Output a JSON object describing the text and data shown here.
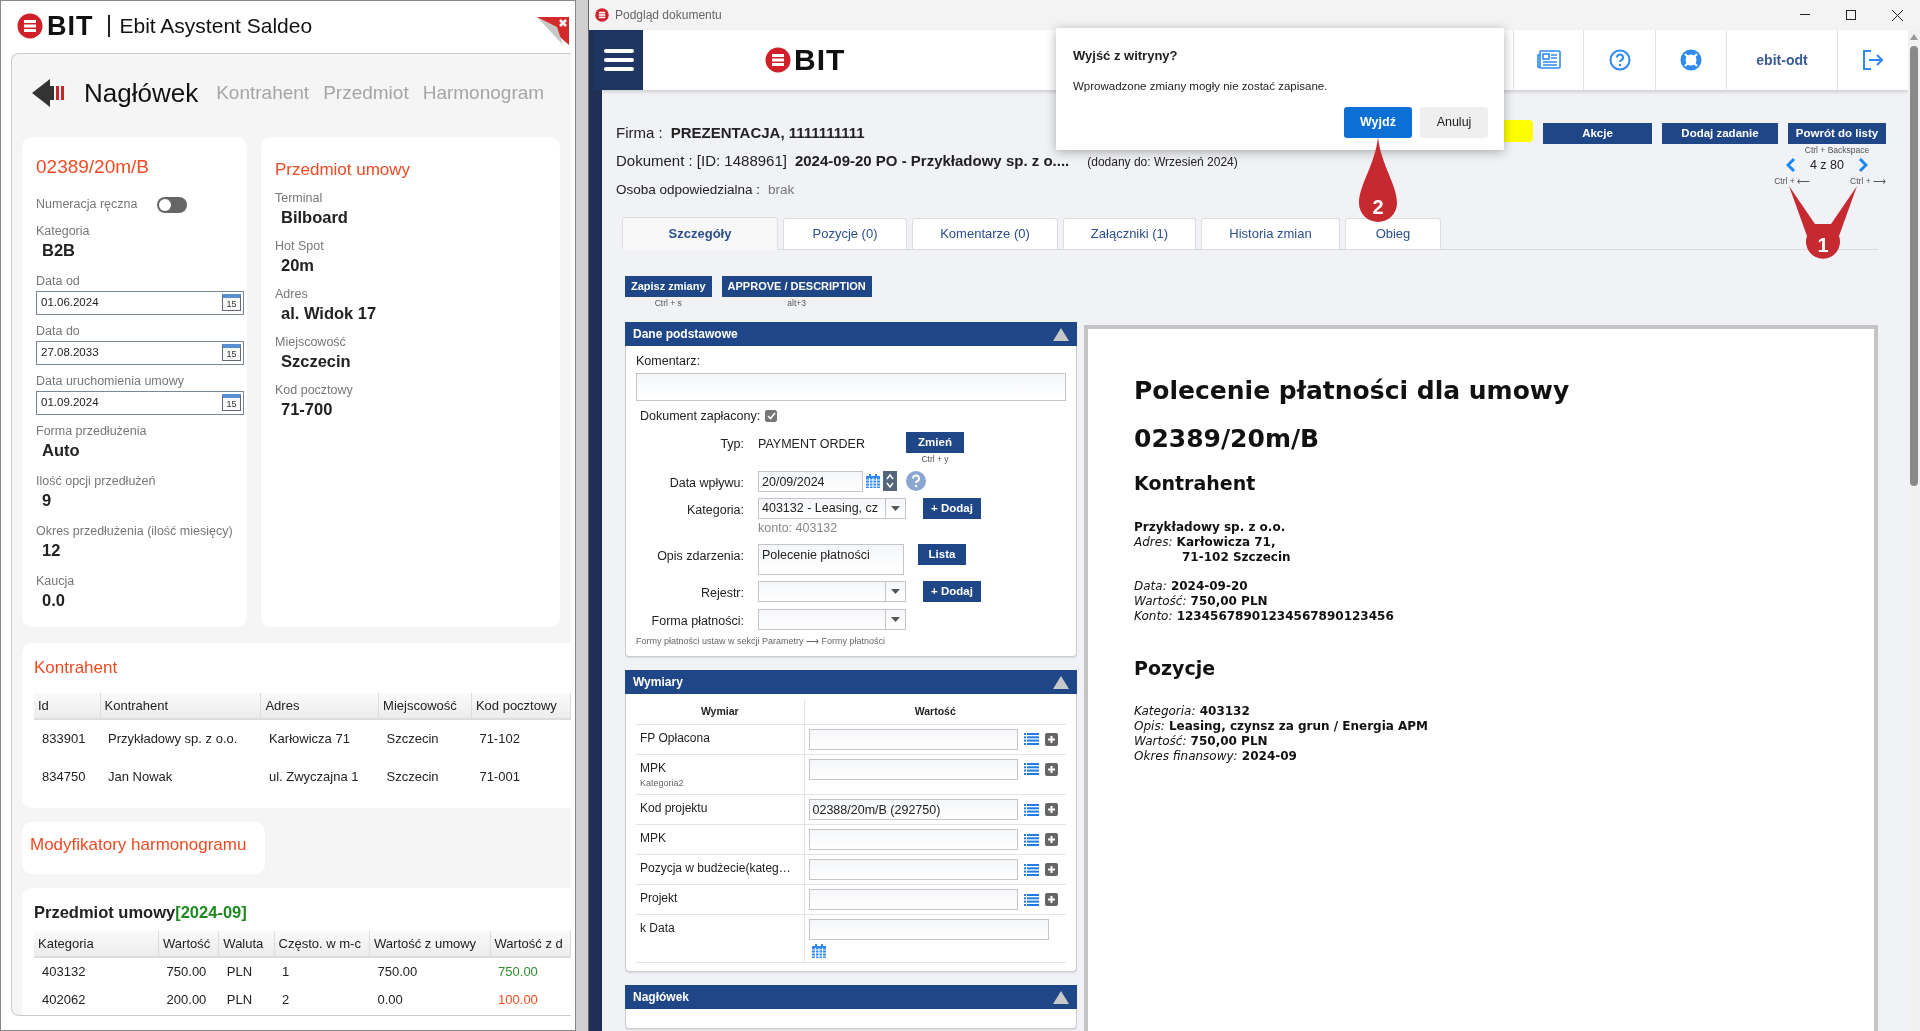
{
  "left_window": {
    "logo_text": "BIT",
    "title": "Ebit Asystent Saldeo",
    "nav": [
      {
        "label": "Nagłówek",
        "selected": true
      },
      {
        "label": "Kontrahent",
        "selected": false
      },
      {
        "label": "Przedmiot",
        "selected": false
      },
      {
        "label": "Harmonogram",
        "selected": false
      }
    ],
    "contract_card": {
      "number": "02389/20m/B",
      "toggle": {
        "label": "Numeracja ręczna",
        "on": false
      },
      "fields": [
        {
          "kind": "value",
          "label": "Kategoria",
          "value": "B2B"
        },
        {
          "kind": "date",
          "label": "Data od",
          "value": "01.06.2024",
          "calendar": "15"
        },
        {
          "kind": "date",
          "label": "Data do",
          "value": "27.08.2033",
          "calendar": "15"
        },
        {
          "kind": "date",
          "label": "Data uruchomienia umowy",
          "value": "01.09.2024",
          "calendar": "15"
        },
        {
          "kind": "value",
          "label": "Forma przedłużenia",
          "value": "Auto"
        },
        {
          "kind": "value",
          "label": "Ilość opcji przedłużeń",
          "value": "9"
        },
        {
          "kind": "value",
          "label": "Okres przedłużenia (ilość miesięcy)",
          "value": "12"
        },
        {
          "kind": "value",
          "label": "Kaucja",
          "value": "0.0"
        }
      ]
    },
    "subject_card": {
      "title": "Przedmiot umowy",
      "fields": [
        {
          "label": "Terminal",
          "value": "Bilboard"
        },
        {
          "label": "Hot Spot",
          "value": "20m"
        },
        {
          "label": "Adres",
          "value": "al. Widok 17"
        },
        {
          "label": "Miejscowość",
          "value": "Szczecin"
        },
        {
          "label": "Kod pocztowy",
          "value": "71-700"
        }
      ]
    },
    "contractors": {
      "title": "Kontrahent",
      "columns": [
        "Id",
        "Kontrahent",
        "Adres",
        "Miejscowość",
        "Kod pocztowy"
      ],
      "rows": [
        [
          "833901",
          "Przykładowy sp. z o.o.",
          "Karłowicza 71",
          "Szczecin",
          "71-102"
        ],
        [
          "834750",
          "Jan Nowak",
          "ul. Zwyczajna 1",
          "Szczecin",
          "71-001"
        ]
      ]
    },
    "modifiers": {
      "title": "Modyfikatory harmonogramu"
    },
    "schedule": {
      "title": "Przedmiot umowy",
      "period": "[2024-09]",
      "columns": [
        "Kategoria",
        "Wartość",
        "Waluta",
        "Często. w m-c",
        "Wartość z umowy",
        "Wartość z d"
      ],
      "rows": [
        {
          "cells": [
            "403132",
            "750.00",
            "PLN",
            "1",
            "750.00",
            "750.00"
          ],
          "color": "#2e8b2e"
        },
        {
          "cells": [
            "402062",
            "200.00",
            "PLN",
            "2",
            "0.00",
            "100.00"
          ],
          "color": "#ff4a1c"
        }
      ]
    }
  },
  "right_window": {
    "title": "Podgląd dokumentu",
    "header": {
      "logo_text": "BIT",
      "user": "ebit-odt"
    },
    "dialog": {
      "title": "Wyjść z witryny?",
      "message": "Wprowadzone zmiany mogły nie zostać zapisane.",
      "buttons": [
        {
          "label": "Wyjdź",
          "kind": "primary"
        },
        {
          "label": "Anuluj",
          "kind": "secondary"
        }
      ]
    },
    "info": {
      "company_label": "Firma :",
      "company": "PREZENTACJA, 1111111111",
      "document_label": "Dokument : [ID: 1488961]",
      "document": "2024-09-20 PO - Przykładowy sp. z o....",
      "document_added": "(dodany do: Wrzesień 2024)",
      "person_label": "Osoba odpowiedzialna :",
      "person": "brak"
    },
    "actions": [
      {
        "label": "Akcje"
      },
      {
        "label": "Dodaj zadanie"
      },
      {
        "label": "Powrót do listy",
        "hint": "Ctrl + Backspace"
      }
    ],
    "pager": {
      "text": "4 z 80",
      "prev_hint": "Ctrl + ⟵",
      "next_hint": "Ctrl + ⟶"
    },
    "tabs": [
      {
        "label": "Szczegóły",
        "selected": true
      },
      {
        "label": "Pozycje (0)",
        "selected": false
      },
      {
        "label": "Komentarze (0)",
        "selected": false
      },
      {
        "label": "Załączniki (1)",
        "selected": false
      },
      {
        "label": "Historia zmian",
        "selected": false
      },
      {
        "label": "Obieg",
        "selected": false
      }
    ],
    "toolbar": [
      {
        "label": "Zapisz zmiany",
        "hint": "Ctrl + s"
      },
      {
        "label": "APPROVE / DESCRIPTION",
        "hint": "alt+3"
      }
    ],
    "basic": {
      "title": "Dane podstawowe",
      "comment_label": "Komentarz:",
      "paid": {
        "label": "Dokument zapłacony:",
        "checked": true
      },
      "type": {
        "label": "Typ:",
        "value": "PAYMENT ORDER",
        "button": "Zmień",
        "hint": "Ctrl + y"
      },
      "date": {
        "label": "Data wpływu:",
        "value": "20/09/2024"
      },
      "category": {
        "label": "Kategoria:",
        "value": "403132 - Leasing, cz",
        "button": "+ Dodaj",
        "account": "konto: 403132"
      },
      "description": {
        "label": "Opis zdarzenia:",
        "value": "Polecenie płatności",
        "button": "Lista"
      },
      "register": {
        "label": "Rejestr:",
        "button": "+ Dodaj"
      },
      "payment": {
        "label": "Forma płatności:"
      },
      "note": "Formy płatności ustaw w sekcji Parametry ⟶ Formy płatności"
    },
    "dimensions": {
      "title": "Wymiary",
      "columns": [
        "Wymiar",
        "Wartość"
      ],
      "rows": [
        {
          "kind": "lookup",
          "label": "FP Opłacona"
        },
        {
          "kind": "lookup",
          "label": "MPK",
          "sublabel": "Kategoria2"
        },
        {
          "kind": "lookup",
          "label": "Kod projektu",
          "value": "02388/20m/B (292750)"
        },
        {
          "kind": "lookup",
          "label": "MPK"
        },
        {
          "kind": "lookup",
          "label": "Pozycja w budżecie(kateg…"
        },
        {
          "kind": "lookup",
          "label": "Projekt"
        },
        {
          "kind": "date",
          "label": "k Data"
        }
      ]
    },
    "header_panel": {
      "title": "Nagłówek"
    },
    "preview": {
      "title": "Polecenie płatności dla umowy",
      "number": "02389/20m/B",
      "sections": [
        {
          "heading": "Kontrahent",
          "blocks": [
            [
              {
                "kind": "name",
                "value": "Przykładowy sp. z o.o."
              },
              {
                "kind": "field",
                "label": "Adres:",
                "value": "Karłowicza 71,"
              },
              {
                "kind": "continuation",
                "value": "71-102 Szczecin"
              }
            ],
            [
              {
                "kind": "field",
                "label": "Data:",
                "value": "2024-09-20"
              },
              {
                "kind": "field",
                "label": "Wartość:",
                "value": "750,00 PLN"
              },
              {
                "kind": "field",
                "label": "Konto:",
                "value": "12345678901234567890123456"
              }
            ]
          ]
        },
        {
          "heading": "Pozycje",
          "blocks": [
            [
              {
                "kind": "field",
                "label": "Kategoria:",
                "value": "403132"
              },
              {
                "kind": "field",
                "label": "Opis:",
                "value": "Leasing, czynsz za grun / Energia APM"
              },
              {
                "kind": "field",
                "label": "Wartość:",
                "value": "750,00 PLN"
              },
              {
                "kind": "field",
                "label": "Okres finansowy:",
                "value": "2024-09"
              }
            ]
          ]
        }
      ]
    },
    "pins": [
      {
        "label": "1",
        "kind": "fork"
      },
      {
        "label": "2",
        "kind": "drop"
      }
    ]
  }
}
